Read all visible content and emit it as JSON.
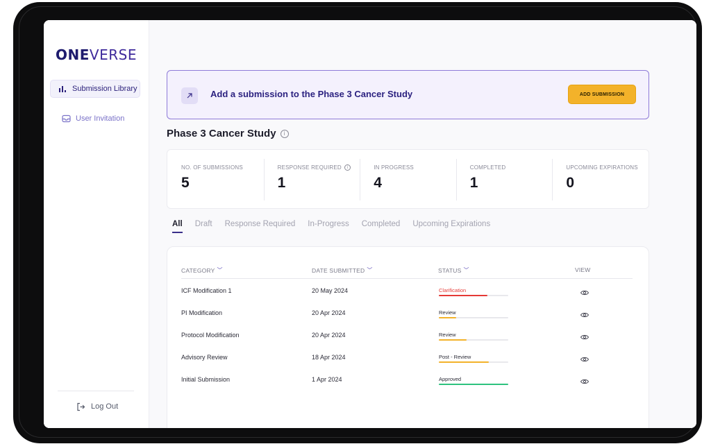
{
  "app": {
    "logo_part1": "ONE",
    "logo_part2": "VERSE"
  },
  "sidebar": {
    "items": [
      {
        "label": "Submission Library",
        "icon": "bar-chart-icon",
        "active": true
      },
      {
        "label": "User Invitation",
        "icon": "inbox-icon",
        "active": false
      }
    ],
    "logout_label": "Log Out"
  },
  "banner": {
    "icon": "arrow-up-right-icon",
    "text": "Add a submission to the Phase 3 Cancer Study",
    "button_label": "ADD SUBMISSION"
  },
  "study": {
    "title": "Phase 3 Cancer Study"
  },
  "stats": [
    {
      "label": "NO. OF SUBMISSIONS",
      "value": "5"
    },
    {
      "label": "RESPONSE REQUIRED",
      "value": "1"
    },
    {
      "label": "IN PROGRESS",
      "value": "4"
    },
    {
      "label": "COMPLETED",
      "value": "1"
    },
    {
      "label": "UPCOMING EXPIRATIONS",
      "value": "0"
    }
  ],
  "tabs": [
    {
      "label": "All",
      "active": true
    },
    {
      "label": "Draft",
      "active": false
    },
    {
      "label": "Response Required",
      "active": false
    },
    {
      "label": "In-Progress",
      "active": false
    },
    {
      "label": "Completed",
      "active": false
    },
    {
      "label": "Upcoming Expirations",
      "active": false
    }
  ],
  "table": {
    "headers": {
      "category": "CATEGORY",
      "date": "DATE  SUBMITTED",
      "status": "STATUS",
      "view": "VIEW"
    },
    "rows": [
      {
        "category": "ICF Modification 1",
        "date": "20 May 2024",
        "status": "Clarification",
        "status_color": "#e53935",
        "progress": 0.7,
        "status_text_color": "#e53935"
      },
      {
        "category": "PI Modification",
        "date": "20 Apr 2024",
        "status": "Review",
        "status_color": "#f3b22a",
        "progress": 0.25,
        "status_text_color": "#2a2a36"
      },
      {
        "category": "Protocol Modification",
        "date": "20 Apr 2024",
        "status": "Review",
        "status_color": "#f3b22a",
        "progress": 0.4,
        "status_text_color": "#2a2a36"
      },
      {
        "category": "Advisory Review",
        "date": "18 Apr 2024",
        "status": "Post - Review",
        "status_color": "#f3b22a",
        "progress": 0.72,
        "status_text_color": "#2a2a36"
      },
      {
        "category": "Initial Submission",
        "date": "1 Apr 2024",
        "status": "Approved",
        "status_color": "#2ec27e",
        "progress": 1.0,
        "status_text_color": "#2a2a36"
      }
    ]
  },
  "colors": {
    "accent": "#3a2f8a",
    "button": "#f3b22a",
    "banner_border": "#8e7ad8"
  }
}
